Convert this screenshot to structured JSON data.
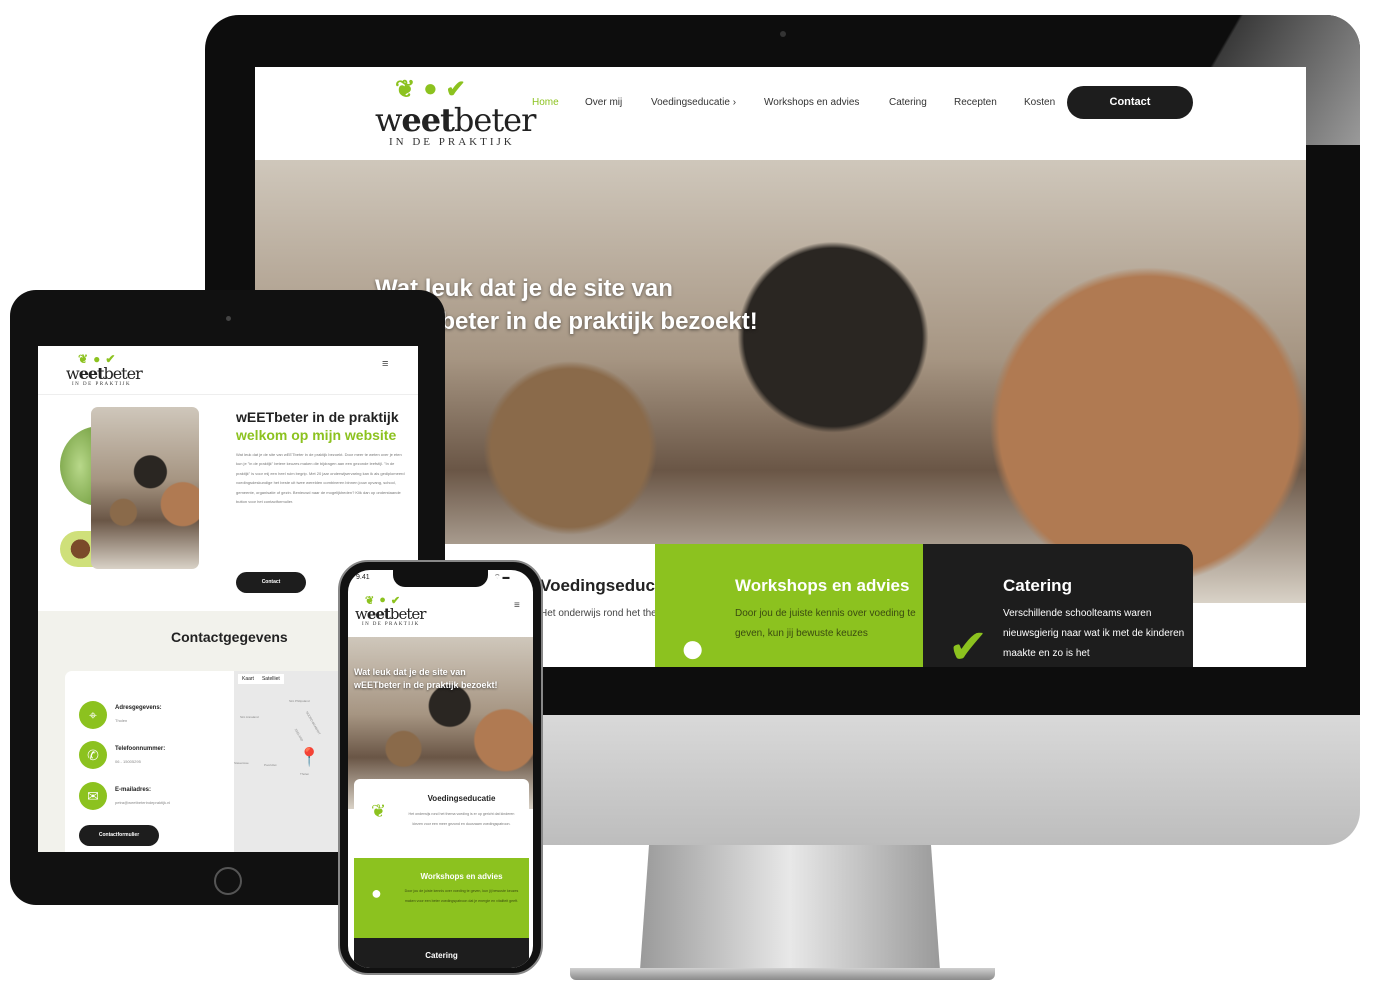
{
  "brand": {
    "name_light1": "w",
    "name_bold": "eet",
    "name_light2": "beter",
    "tagline": "IN DE PRAKTIJK",
    "accent": "#8cc21f",
    "dark": "#1d1d1d"
  },
  "desktop": {
    "nav": [
      {
        "label": "Home",
        "active": true
      },
      {
        "label": "Over mij"
      },
      {
        "label": "Voedingseducatie ›"
      },
      {
        "label": "Workshops en advies"
      },
      {
        "label": "Catering"
      },
      {
        "label": "Recepten"
      },
      {
        "label": "Kosten"
      }
    ],
    "contact_button": "Contact",
    "hero_line1": "Wat leuk dat je de site van",
    "hero_line2": "wEETbeter in de praktijk bezoekt!",
    "cards": [
      {
        "title": "Voedingseducatie",
        "text": "Het onderwijs rond het thema voeding is er op gericht dat kinderen kiezen voor een meer gezond en duurzaam voedingspatroon.",
        "icon": "pea-icon"
      },
      {
        "title": "Workshops en advies",
        "text": "Door jou de juiste kennis over voeding te geven, kun jij bewuste keuzes",
        "icon": "pepper-icon"
      },
      {
        "title": "Catering",
        "text": "Verschillende schoolteams waren nieuwsgierig naar wat ik met de kinderen maakte en zo is het",
        "icon": "checkmark-icon"
      }
    ]
  },
  "tablet": {
    "title": "wEETbeter in de praktijk",
    "subtitle": "welkom op mijn website",
    "intro": "Wat leuk dat je de site van wEETbeter in de praktijk bezoekt. Door meer te weten over je eten kun je \"in de praktijk\" betere keuzes maken die bijdragen aan een gezonde leefstijl. \"In de praktijk\" is voor mij een heel ruim begrip. Met 20 jaar onderwijservaring kan ik als gediplomeerd voedingsdeskundige het beste uit twee werelden combineren binnen jouw opvang, school, gemeente, organisatie of gezin. Benieuwd naar de mogelijkheden? Klik dan op onderstaande button voor het contactformulier.",
    "contact_button": "Contact",
    "contact_heading": "Contactgegevens",
    "contacts": [
      {
        "label": "Adresgegevens:",
        "value": "Tholen",
        "icon": "location-pin-icon"
      },
      {
        "label": "Telefoonnummer:",
        "value": "06 - 15005295",
        "icon": "phone-icon"
      },
      {
        "label": "E-mailadres:",
        "value": "petra@weetbeterindepraktijk.nl",
        "icon": "mail-icon"
      }
    ],
    "form_button": "Contactformulier",
    "map": {
      "tab_map": "Kaart",
      "tab_satellite": "Satelliet",
      "labels": [
        "Sint Philipsland",
        "Sint Annaland",
        "NOORD-BRABANT",
        "ZEELAND",
        "Stavenisse",
        "Poortvliet",
        "Tholen"
      ]
    }
  },
  "phone": {
    "time": "9.41",
    "hero_line1": "Wat leuk dat je de site van",
    "hero_line2": "wEETbeter in de praktijk bezoekt!",
    "cards": [
      {
        "title": "Voedingseducatie",
        "text": "Het onderwijs rond het thema voeding is er op gericht dat kinderen kiezen voor een meer gezond en duurzaam voedingspatroon."
      },
      {
        "title": "Workshops en advies",
        "text": "Door jou de juiste kennis over voeding te geven, kun jij bewuste keuzes maken voor een beter voedingspatroon dat je energie en vitaliteit geeft."
      },
      {
        "title": "Catering"
      }
    ]
  }
}
